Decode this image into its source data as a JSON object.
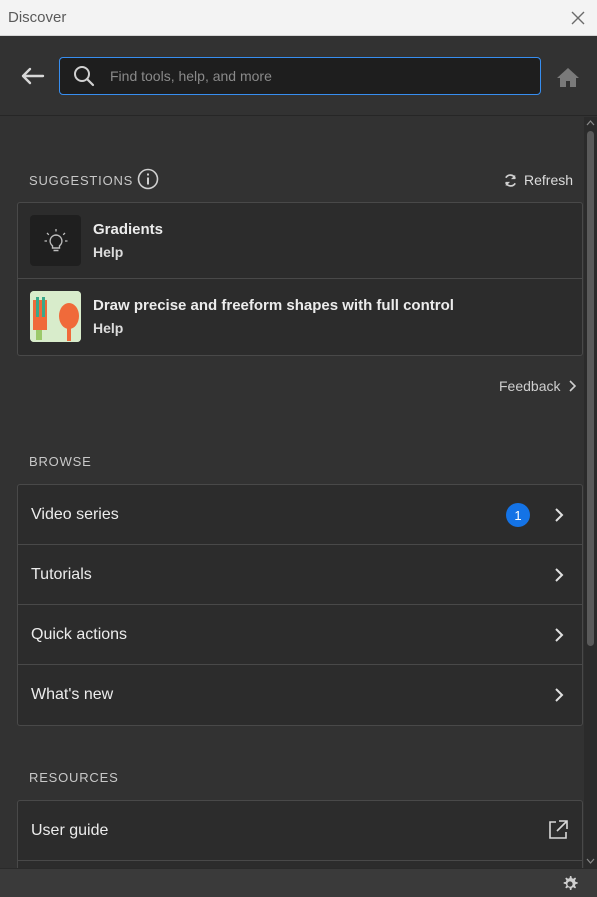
{
  "window": {
    "title": "Discover"
  },
  "header": {
    "search_placeholder": "Find tools, help, and more"
  },
  "suggestions": {
    "label": "SUGGESTIONS",
    "refresh_label": "Refresh",
    "items": [
      {
        "title": "Gradients",
        "subtitle": "Help",
        "icon": "lightbulb-icon"
      },
      {
        "title": "Draw precise and freeform shapes with full control",
        "subtitle": "Help",
        "icon": "shapes-thumbnail"
      }
    ],
    "feedback_label": "Feedback"
  },
  "browse": {
    "label": "BROWSE",
    "items": [
      {
        "label": "Video series",
        "badge": "1"
      },
      {
        "label": "Tutorials"
      },
      {
        "label": "Quick actions"
      },
      {
        "label": "What's new"
      }
    ]
  },
  "resources": {
    "label": "RESOURCES",
    "items": [
      {
        "label": "User guide",
        "icon": "external-link-icon"
      }
    ]
  },
  "colors": {
    "accent": "#378ef0",
    "badge": "#1473e6",
    "background": "#323232"
  }
}
